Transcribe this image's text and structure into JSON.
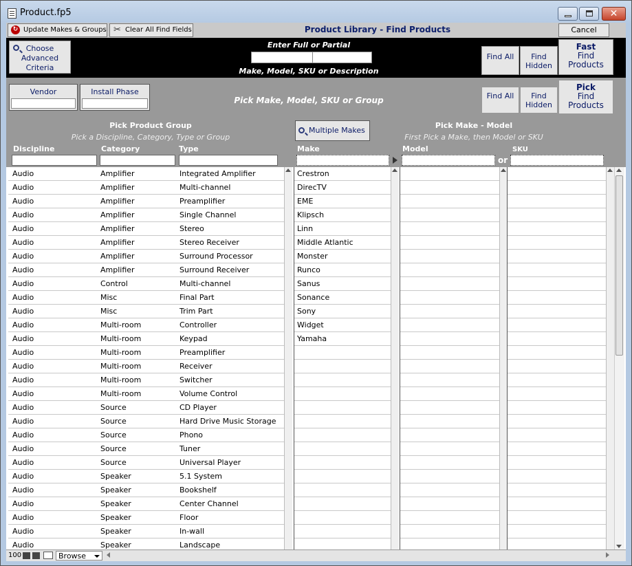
{
  "window": {
    "title": "Product.fp5",
    "close_glyph": "✕"
  },
  "toolbar": {
    "update_label": "Update Makes & Groups",
    "clear_label": "Clear All Find Fields",
    "title": "Product Library - Find Products",
    "cancel_label": "Cancel"
  },
  "search": {
    "choose_label": "Choose Advanced Criteria",
    "enter_label": "Enter Full or Partial",
    "make_label": "Make, Model, SKU or Description",
    "find_all": "Find All",
    "find_hidden": "Find Hidden",
    "fast_find_line1": "Fast",
    "fast_find_line2": "Find Products"
  },
  "pick": {
    "vendor_label": "Vendor",
    "install_label": "Install Phase",
    "pick_mm_label": "Pick Make, Model, SKU or Group",
    "find_all": "Find All",
    "find_hidden": "Find Hidden",
    "pick_find_line1": "Pick",
    "pick_find_line2": "Find Products",
    "group_title": "Pick Product Group",
    "group_sub": "Pick a Discipline, Category, Type or Group",
    "multiple_makes": "Multiple Makes",
    "make_model_title": "Pick Make - Model",
    "make_model_sub": "First Pick a Make, then Model or SKU",
    "col_discipline": "Discipline",
    "col_category": "Category",
    "col_type": "Type",
    "col_make": "Make",
    "col_model": "Model",
    "col_sku": "SKU",
    "or_label": "or"
  },
  "groups": [
    [
      "Audio",
      "Amplifier",
      "Integrated Amplifier"
    ],
    [
      "Audio",
      "Amplifier",
      "Multi-channel"
    ],
    [
      "Audio",
      "Amplifier",
      "Preamplifier"
    ],
    [
      "Audio",
      "Amplifier",
      "Single Channel"
    ],
    [
      "Audio",
      "Amplifier",
      "Stereo"
    ],
    [
      "Audio",
      "Amplifier",
      "Stereo Receiver"
    ],
    [
      "Audio",
      "Amplifier",
      "Surround Processor"
    ],
    [
      "Audio",
      "Amplifier",
      "Surround Receiver"
    ],
    [
      "Audio",
      "Control",
      "Multi-channel"
    ],
    [
      "Audio",
      "Misc",
      "Final Part"
    ],
    [
      "Audio",
      "Misc",
      "Trim Part"
    ],
    [
      "Audio",
      "Multi-room",
      "Controller"
    ],
    [
      "Audio",
      "Multi-room",
      "Keypad"
    ],
    [
      "Audio",
      "Multi-room",
      "Preamplifier"
    ],
    [
      "Audio",
      "Multi-room",
      "Receiver"
    ],
    [
      "Audio",
      "Multi-room",
      "Switcher"
    ],
    [
      "Audio",
      "Multi-room",
      "Volume Control"
    ],
    [
      "Audio",
      "Source",
      "CD Player"
    ],
    [
      "Audio",
      "Source",
      "Hard Drive Music Storage"
    ],
    [
      "Audio",
      "Source",
      "Phono"
    ],
    [
      "Audio",
      "Source",
      "Tuner"
    ],
    [
      "Audio",
      "Source",
      "Universal Player"
    ],
    [
      "Audio",
      "Speaker",
      "5.1 System"
    ],
    [
      "Audio",
      "Speaker",
      "Bookshelf"
    ],
    [
      "Audio",
      "Speaker",
      "Center Channel"
    ],
    [
      "Audio",
      "Speaker",
      "Floor"
    ],
    [
      "Audio",
      "Speaker",
      "In-wall"
    ],
    [
      "Audio",
      "Speaker",
      "Landscape"
    ]
  ],
  "makes": [
    "Crestron",
    "DirecTV",
    "EME",
    "Klipsch",
    "Linn",
    "Middle Atlantic",
    "Monster",
    "Runco",
    "Sanus",
    "Sonance",
    "Sony",
    "Widget",
    "Yamaha"
  ],
  "status": {
    "zoom": "100",
    "mode": "Browse"
  }
}
